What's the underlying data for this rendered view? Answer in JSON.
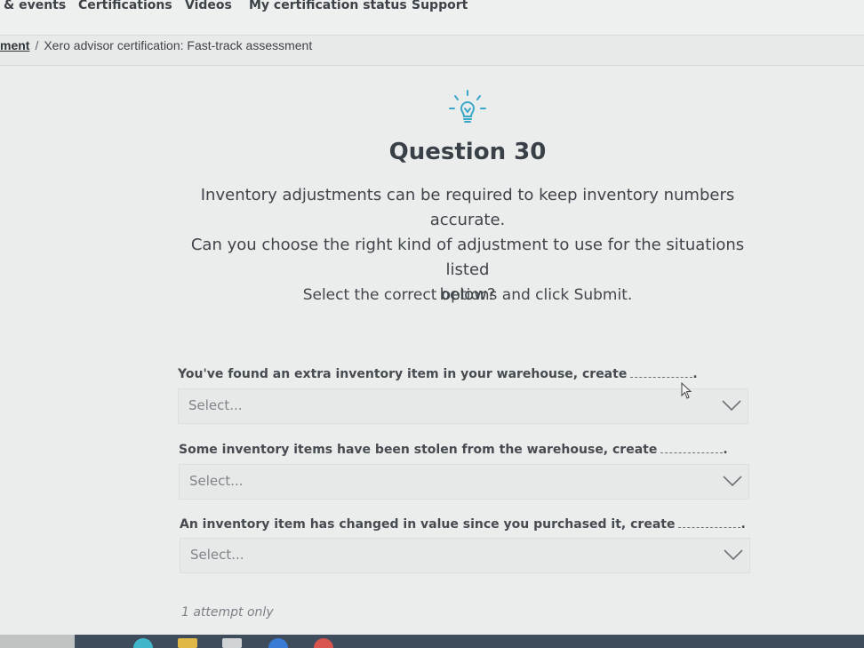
{
  "nav": {
    "items": [
      "& events",
      "Certifications",
      "Videos",
      "My certification status",
      "Support"
    ]
  },
  "breadcrumb": {
    "parent": "ment",
    "separator": "/",
    "current": "Xero advisor certification: Fast-track assessment"
  },
  "question": {
    "title": "Question 30",
    "line1": "Inventory adjustments can be required to keep inventory numbers accurate.",
    "line2": "Can you choose the right kind of adjustment to use for the situations listed",
    "line3": "below?",
    "instruction": "Select the correct options and click Submit."
  },
  "items": [
    {
      "label": "You've found an extra inventory item in your warehouse, create",
      "suffix": ".",
      "select_placeholder": "Select..."
    },
    {
      "label": "Some inventory items have been stolen from the warehouse, create",
      "suffix": ".",
      "select_placeholder": "Select..."
    },
    {
      "label": "An inventory item has changed in value since you purchased it, create",
      "suffix": ".",
      "select_placeholder": "Select..."
    }
  ],
  "footer": {
    "attempts": "1 attempt only"
  },
  "icons": {
    "bulb": "lightbulb-icon",
    "chevron": "chevron-down-icon",
    "cursor": "mouse-cursor-icon"
  },
  "colors": {
    "text": "#3a4047",
    "background": "#ebedec",
    "taskbar": "#3f4c5c"
  }
}
